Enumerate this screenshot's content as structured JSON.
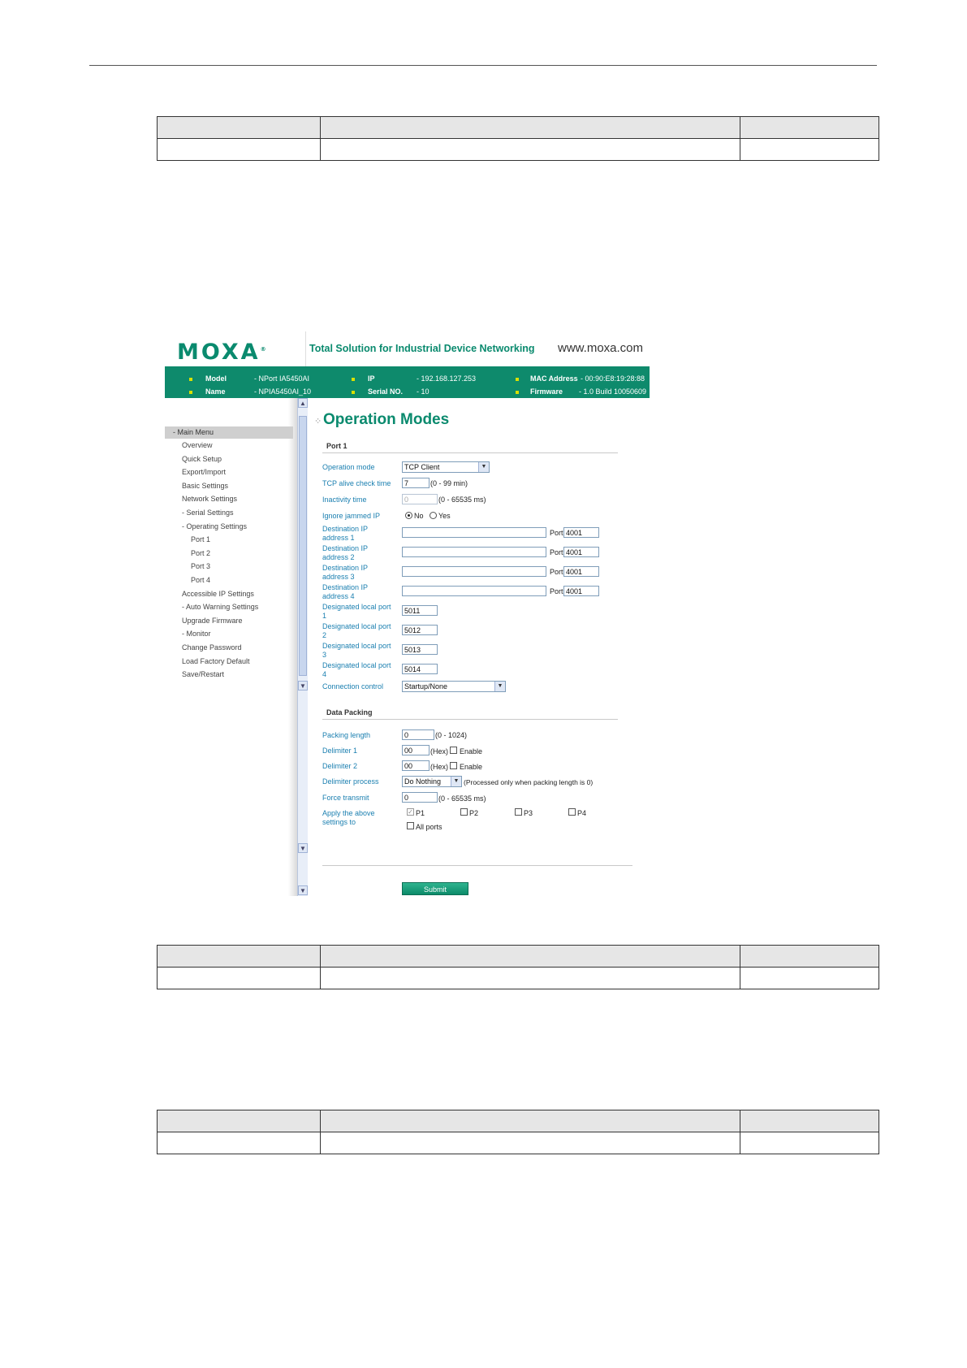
{
  "screenshot": {
    "logo_text": "MOXA",
    "tagline": "Total Solution for Industrial Device Networking",
    "website": "www.moxa.com",
    "info": {
      "model_label": "Model",
      "model_value": "- NPort IA5450AI",
      "name_label": "Name",
      "name_value": "- NPIA5450AI_10",
      "ip_label": "IP",
      "ip_value": "- 192.168.127.253",
      "serial_label": "Serial NO.",
      "serial_value": "- 10",
      "mac_label": "MAC Address",
      "mac_value": "- 00:90:E8:19:28:88",
      "firmware_label": "Firmware",
      "firmware_value": "- 1.0 Build 10050609"
    },
    "sidebar": {
      "main_menu": "- Main Menu",
      "items": [
        "Overview",
        "Quick Setup",
        "Export/Import",
        "Basic Settings",
        "Network Settings",
        "- Serial Settings",
        "- Operating Settings",
        "Port 1",
        "Port 2",
        "Port 3",
        "Port 4",
        "Accessible IP Settings",
        "- Auto Warning Settings",
        "Upgrade Firmware",
        "- Monitor",
        "Change Password",
        "Load Factory Default",
        "Save/Restart"
      ]
    },
    "page_title": "Operation Modes",
    "port_section": "Port 1",
    "operation_mode_label": "Operation mode",
    "operation_mode_value": "TCP Client",
    "tcp_alive_label": "TCP alive check time",
    "tcp_alive_value": "7",
    "tcp_alive_hint": "(0 - 99 min)",
    "inactivity_label": "Inactivity time",
    "inactivity_value": "0",
    "inactivity_hint": "(0 - 65535 ms)",
    "ignore_jammed_label": "Ignore jammed IP",
    "ignore_no": "No",
    "ignore_yes": "Yes",
    "destinations": [
      {
        "label1": "Destination IP",
        "label2": "address 1",
        "ip": "",
        "port_label": "Port",
        "port": "4001"
      },
      {
        "label1": "Destination IP",
        "label2": "address 2",
        "ip": "",
        "port_label": "Port",
        "port": "4001"
      },
      {
        "label1": "Destination IP",
        "label2": "address 3",
        "ip": "",
        "port_label": "Port",
        "port": "4001"
      },
      {
        "label1": "Destination IP",
        "label2": "address 4",
        "ip": "",
        "port_label": "Port",
        "port": "4001"
      }
    ],
    "local_ports": [
      {
        "label1": "Designated local port",
        "label2": "1",
        "value": "5011"
      },
      {
        "label1": "Designated local port",
        "label2": "2",
        "value": "5012"
      },
      {
        "label1": "Designated local port",
        "label2": "3",
        "value": "5013"
      },
      {
        "label1": "Designated local port",
        "label2": "4",
        "value": "5014"
      }
    ],
    "connection_control_label": "Connection control",
    "connection_control_value": "Startup/None",
    "data_packing_section": "Data Packing",
    "packing_length_label": "Packing length",
    "packing_length_value": "0",
    "packing_length_hint": "(0 - 1024)",
    "delimiter1_label": "Delimiter 1",
    "delimiter1_value": "00",
    "delimiter2_label": "Delimiter 2",
    "delimiter2_value": "00",
    "hex_hint": "(Hex)",
    "enable_label": "Enable",
    "delimiter_process_label": "Delimiter process",
    "delimiter_process_value": "Do Nothing",
    "delimiter_process_hint": "(Processed only when packing length is 0)",
    "force_transmit_label": "Force transmit",
    "force_transmit_value": "0",
    "force_transmit_hint": "(0 - 65535 ms)",
    "apply_label1": "Apply the above",
    "apply_label2": "settings to",
    "apply_ports": [
      "P1",
      "P2",
      "P3",
      "P4"
    ],
    "all_ports": "All ports",
    "submit": "Submit"
  },
  "colors": {
    "brand_green": "#0e8a6c",
    "label_blue": "#1a7fb0"
  }
}
